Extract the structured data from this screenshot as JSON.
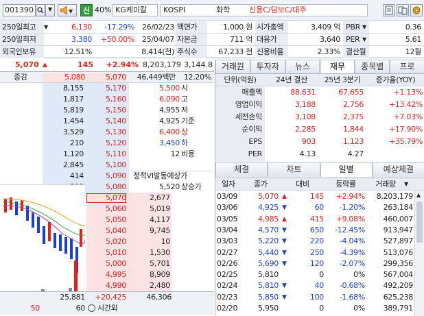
{
  "toolbar": {
    "code": "001390",
    "badge_credit": "신",
    "margin_rate": "40%",
    "stock_name": "KG케미칼",
    "market": "KOSPI",
    "sector": "화학",
    "tags": "신용C/담보C/대주"
  },
  "info": {
    "row1": {
      "label": "250일최고",
      "price": "6,130",
      "rate": "-17.29%",
      "date": "26/02/23",
      "k1": "액면가",
      "v1": "1,000 원",
      "k2": "시가총액",
      "v2": "3,409 억",
      "k3": "PBR",
      "v3": "0.36"
    },
    "row2": {
      "label": "250일최저",
      "price": "3,380",
      "rate": "+50.00%",
      "date": "25/04/07",
      "k1": "자본금",
      "v1": "711 억",
      "k2": "대용가",
      "v2": "3,640",
      "k3": "PER",
      "v3": "5.61"
    },
    "row3": {
      "label": "외국인보유",
      "pct": "12.51%",
      "shares": "8,414(천)",
      "k1": "주식수",
      "v1": "67,233 천",
      "k2": "신용비율",
      "v2": "2.33%",
      "k3": "결산월",
      "v3": "12월"
    }
  },
  "quote": {
    "price": "5,070",
    "change": "145",
    "rate": "+2.94%",
    "volume": "8,203,179",
    "prev": "3,144.8"
  },
  "orderbook": {
    "header": {
      "label": "증감",
      "price": "5,080",
      "price2": "5,070",
      "amount": "46,449백만",
      "ratio": "12.20%"
    },
    "asks": [
      {
        "qty": "8,155",
        "price": "5,170",
        "side_val": "5,500",
        "side_lbl": "시"
      },
      {
        "qty": "1,817",
        "price": "5,160",
        "side_val": "6,090",
        "side_lbl": "고"
      },
      {
        "qty": "5,819",
        "price": "5,150",
        "side_val": "4,955",
        "side_lbl": "저"
      },
      {
        "qty": "1,454",
        "price": "5,140",
        "side_val": "4,925",
        "side_lbl": "기준"
      },
      {
        "qty": "3,529",
        "price": "5,130",
        "side_val": "6,400",
        "side_lbl": "상"
      },
      {
        "qty": "210",
        "price": "5,120",
        "side_val": "3,450",
        "side_lbl": "하"
      },
      {
        "qty": "1,120",
        "price": "5,110",
        "side_val": "12",
        "side_lbl": "비용"
      },
      {
        "qty": "2,845",
        "price": "5,100",
        "side_val": "",
        "side_lbl": ""
      },
      {
        "qty": "414",
        "price": "5,090",
        "side_val": "5,520",
        "side_lbl": "상승가"
      },
      {
        "qty": "518",
        "price": "5,080",
        "side_val": "4,505",
        "side_lbl": "하락가"
      }
    ],
    "vi_label": "정적VI발동예상가",
    "bids": [
      {
        "price": "5,070",
        "qty": "2,677"
      },
      {
        "price": "5,060",
        "qty": "5,019"
      },
      {
        "price": "5,050",
        "qty": "4,117"
      },
      {
        "price": "5,040",
        "qty": "9,745"
      },
      {
        "price": "5,020",
        "qty": "10"
      },
      {
        "price": "5,010",
        "qty": "1,530"
      },
      {
        "price": "5,000",
        "qty": "5,701"
      },
      {
        "price": "4,995",
        "qty": "8,909"
      },
      {
        "price": "4,990",
        "qty": "2,480"
      },
      {
        "price": "4,985",
        "qty": "6,028"
      }
    ],
    "footer": {
      "ask_total": "25,881",
      "change": "+20,425",
      "bid_total": "46,306",
      "left1": "50",
      "left2": "60",
      "time_label": "시간외"
    }
  },
  "tabs_top": [
    "거래원",
    "투자자",
    "뉴스",
    "재무",
    "종목별",
    "프로"
  ],
  "tabs_top_selected": 3,
  "finance": {
    "headers": [
      "단위(억원)",
      "24년 결산",
      "25년 3분기",
      "증가율(YOY)"
    ],
    "rows": [
      {
        "label": "매출액",
        "a": "88,631",
        "b": "67,655",
        "g": "+1.13%"
      },
      {
        "label": "영업이익",
        "a": "3,188",
        "b": "2,756",
        "g": "+13.42%"
      },
      {
        "label": "세전손익",
        "a": "3,108",
        "b": "2,375",
        "g": "+7.03%"
      },
      {
        "label": "순이익",
        "a": "2,285",
        "b": "1,844",
        "g": "+17.90%"
      },
      {
        "label": "EPS",
        "a": "903",
        "b": "1,123",
        "g": "+35.79%"
      },
      {
        "label": "PER",
        "a": "4.13",
        "b": "4.27",
        "g": ""
      }
    ]
  },
  "tabs_bottom": [
    "체결",
    "차트",
    "일별",
    "예상체결"
  ],
  "tabs_bottom_selected": 2,
  "daily": {
    "headers": [
      "일자",
      "종가",
      "대비",
      "등락률",
      "거래량"
    ],
    "rows": [
      {
        "date": "03/09",
        "close": "5,070",
        "dir": "up",
        "diff": "145",
        "rate": "+2.94%",
        "vol": "8,203,179"
      },
      {
        "date": "03/06",
        "close": "4,925",
        "dir": "down",
        "diff": "60",
        "rate": "-1.20%",
        "vol": "263,184"
      },
      {
        "date": "03/05",
        "close": "4,985",
        "dir": "up",
        "diff": "415",
        "rate": "+9.08%",
        "vol": "460,007"
      },
      {
        "date": "03/04",
        "close": "4,570",
        "dir": "down",
        "diff": "650",
        "rate": "-12.45%",
        "vol": "913,947"
      },
      {
        "date": "03/03",
        "close": "5,220",
        "dir": "down",
        "diff": "220",
        "rate": "-4.04%",
        "vol": "527,897"
      },
      {
        "date": "02/27",
        "close": "5,440",
        "dir": "down",
        "diff": "250",
        "rate": "-4.39%",
        "vol": "513,076"
      },
      {
        "date": "02/26",
        "close": "5,690",
        "dir": "down",
        "diff": "120",
        "rate": "-2.07%",
        "vol": "299,356"
      },
      {
        "date": "02/25",
        "close": "5,810",
        "dir": "flat",
        "diff": "0",
        "rate": "0%",
        "vol": "567,004"
      },
      {
        "date": "02/24",
        "close": "5,810",
        "dir": "down",
        "diff": "40",
        "rate": "-0.68%",
        "vol": "492,209"
      },
      {
        "date": "02/23",
        "close": "5,850",
        "dir": "down",
        "diff": "100",
        "rate": "-1.68%",
        "vol": "625,238"
      },
      {
        "date": "02/20",
        "close": "5,950",
        "dir": "flat",
        "diff": "0",
        "rate": "0%",
        "vol": "389,791"
      }
    ]
  },
  "colors": {
    "up": "#e0201a",
    "down": "#1a3fd0",
    "ask_bg": "#dfe9f8",
    "bid_bg": "#fbe3e3",
    "header_bg": "#e9edf3"
  }
}
